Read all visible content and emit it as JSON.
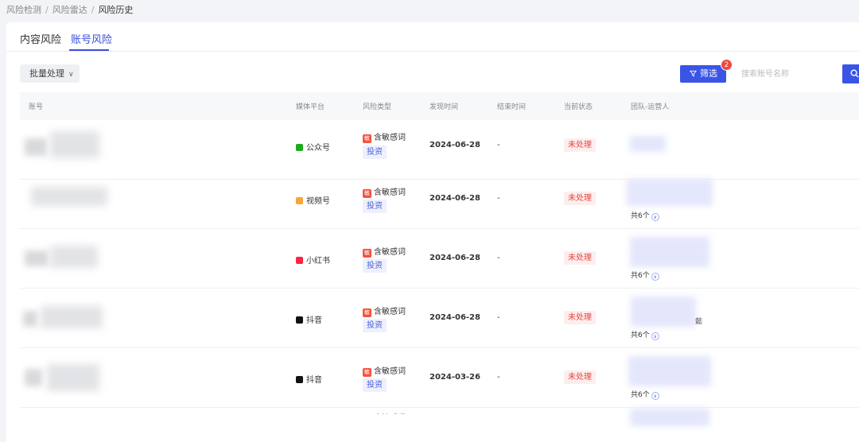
{
  "breadcrumb": [
    "风险检测",
    "风险雷达",
    "风险历史"
  ],
  "breadcrumb_sep": "/",
  "tabs": [
    {
      "label": "内容风险",
      "active": false
    },
    {
      "label": "账号风险",
      "active": true
    }
  ],
  "toolbar": {
    "batch_label": "批量处理",
    "filter_label": "筛选",
    "filter_badge": "2",
    "search_placeholder": "搜索账号名称"
  },
  "table": {
    "columns": [
      "账号",
      "媒体平台",
      "风险类型",
      "发现时间",
      "结束时间",
      "当前状态",
      "团队-运营人"
    ],
    "rows": [
      {
        "platform": "公众号",
        "platform_icon": "wechat-official-icon",
        "platform_color": "#1aad19",
        "risk_badge": "敏",
        "risk_type": "含敏感词",
        "risk_tag": "投资",
        "found_time": "2024-06-28",
        "end_time": "-",
        "status": "未处理",
        "operator_total": ""
      },
      {
        "platform": "视频号",
        "platform_icon": "channels-icon",
        "platform_color": "#f7a534",
        "risk_badge": "敏",
        "risk_type": "含敏感词",
        "risk_tag": "投资",
        "found_time": "2024-06-28",
        "end_time": "-",
        "status": "未处理",
        "operator_total": "共6个"
      },
      {
        "platform": "小红书",
        "platform_icon": "xiaohongshu-icon",
        "platform_color": "#ff2442",
        "risk_badge": "敏",
        "risk_type": "含敏感词",
        "risk_tag": "投资",
        "found_time": "2024-06-28",
        "end_time": "-",
        "status": "未处理",
        "operator_total": "共6个"
      },
      {
        "platform": "抖音",
        "platform_icon": "douyin-icon",
        "platform_color": "#111111",
        "risk_badge": "敏",
        "risk_type": "含敏感词",
        "risk_tag": "投资",
        "found_time": "2024-06-28",
        "end_time": "-",
        "status": "未处理",
        "operator_total": "共6个",
        "operator_extra": "懿"
      },
      {
        "platform": "抖音",
        "platform_icon": "douyin-icon",
        "platform_color": "#111111",
        "risk_badge": "敏",
        "risk_type": "含敏感词",
        "risk_tag": "投资",
        "found_time": "2024-03-26",
        "end_time": "-",
        "status": "未处理",
        "operator_total": "共6个"
      }
    ],
    "partial_row": {
      "risk_badge": "敏",
      "risk_type": "含敏感词"
    }
  },
  "colors": {
    "accent": "#3a55e6",
    "danger": "#e8453c",
    "badge": "#f0463c"
  }
}
